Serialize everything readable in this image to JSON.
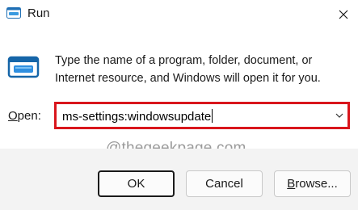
{
  "window": {
    "title": "Run",
    "title_icon": "run-icon",
    "close_icon": "close-icon"
  },
  "description": "Type the name of a program, folder, document, or Internet resource, and Windows will open it for you.",
  "open_field": {
    "label_mnemonic": "O",
    "label_rest": "pen:",
    "value": "ms-settings:windowsupdate",
    "highlight_color": "#d9161c"
  },
  "watermark": "@thegeekpage.com",
  "buttons": {
    "ok": "OK",
    "cancel": "Cancel",
    "browse_mnemonic": "B",
    "browse_rest": "rowse..."
  }
}
